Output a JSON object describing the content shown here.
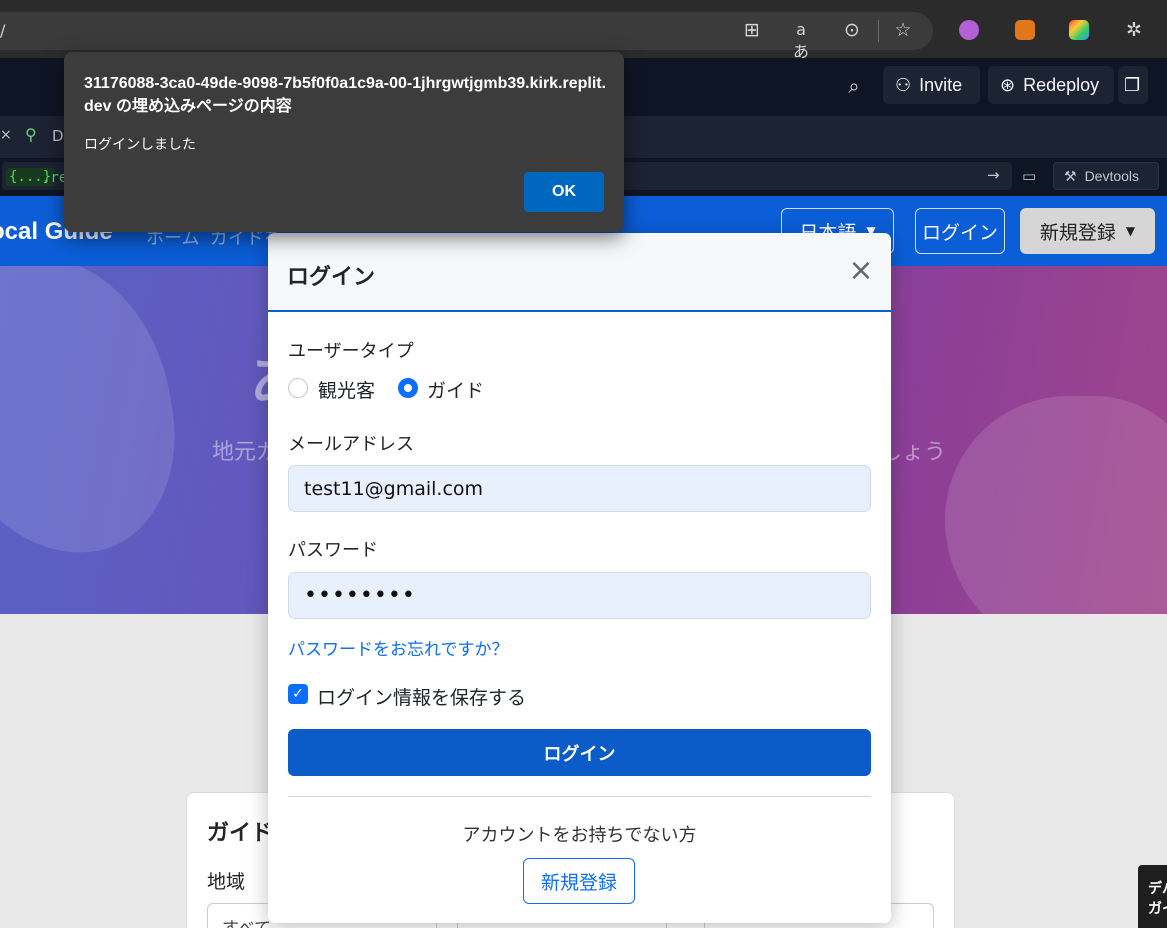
{
  "browser": {
    "url_fragment": "/",
    "icons": [
      "app-grid-icon",
      "read-aloud-icon",
      "more-icon",
      "favorite-star-icon",
      "extensions-icon"
    ]
  },
  "replit": {
    "invite_label": "Invite",
    "redeploy_label": "Redeploy",
    "tab_label": "Dε",
    "url_badge": "{...}",
    "url_rest": ".rep",
    "devtools_label": "Devtools"
  },
  "site": {
    "brand": "ocal Guide",
    "nav_links": [
      "ホーム",
      "ガイドを"
    ],
    "language_label": "日本語",
    "login_label": "ログイン",
    "signup_label": "新規登録",
    "hero_heading_fragment": "あ",
    "hero_subtitle_left": "地元ガ",
    "hero_subtitle_right": "しょう",
    "search_title": "ガイドを",
    "region_label": "地域",
    "region_select_value": "すべて",
    "toast_lines": [
      "デバ",
      "ガイ"
    ]
  },
  "modal": {
    "title": "ログイン",
    "close_symbol": "×",
    "user_type_label": "ユーザータイプ",
    "user_types": [
      {
        "label": "観光客",
        "checked": false
      },
      {
        "label": "ガイド",
        "checked": true
      }
    ],
    "email_label": "メールアドレス",
    "email_value": "test11@gmail.com",
    "password_label": "パスワード",
    "password_mask": "••••••••",
    "forgot_password": "パスワードをお忘れですか？",
    "remember_label": "ログイン情報を保存する",
    "remember_checked": true,
    "submit_label": "ログイン",
    "no_account_text": "アカウントをお持ちでない方",
    "signup_label": "新規登録"
  },
  "alert": {
    "title": "31176088-3ca0-49de-9098-7b5f0f0a1c9a-00-1jhrgwtjgmb39.kirk.replit.dev の埋め込みページの内容",
    "message": "ログインしました",
    "ok_label": "OK"
  },
  "colors": {
    "primary": "#0b5ed7",
    "alert_bg": "#3c3c3c",
    "replit_bg": "#0e1525"
  }
}
